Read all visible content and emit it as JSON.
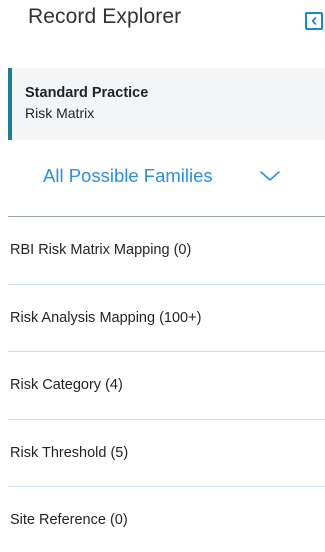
{
  "header": {
    "title": "Record Explorer",
    "collapse_icon": "collapse-left-icon",
    "accent_color": "#1a87c8"
  },
  "practice": {
    "title": "Standard Practice",
    "subtitle": "Risk Matrix",
    "accent_color": "#1c7d94"
  },
  "family_filter": {
    "selected": "All Possible Families",
    "icon": "chevron-down-icon",
    "color": "#2b8ee0"
  },
  "families": [
    {
      "label": "RBI Risk Matrix Mapping (0)"
    },
    {
      "label": "Risk Analysis Mapping (100+)"
    },
    {
      "label": "Risk Category (4)"
    },
    {
      "label": "Risk Threshold (5)"
    },
    {
      "label": "Site Reference (0)"
    }
  ]
}
